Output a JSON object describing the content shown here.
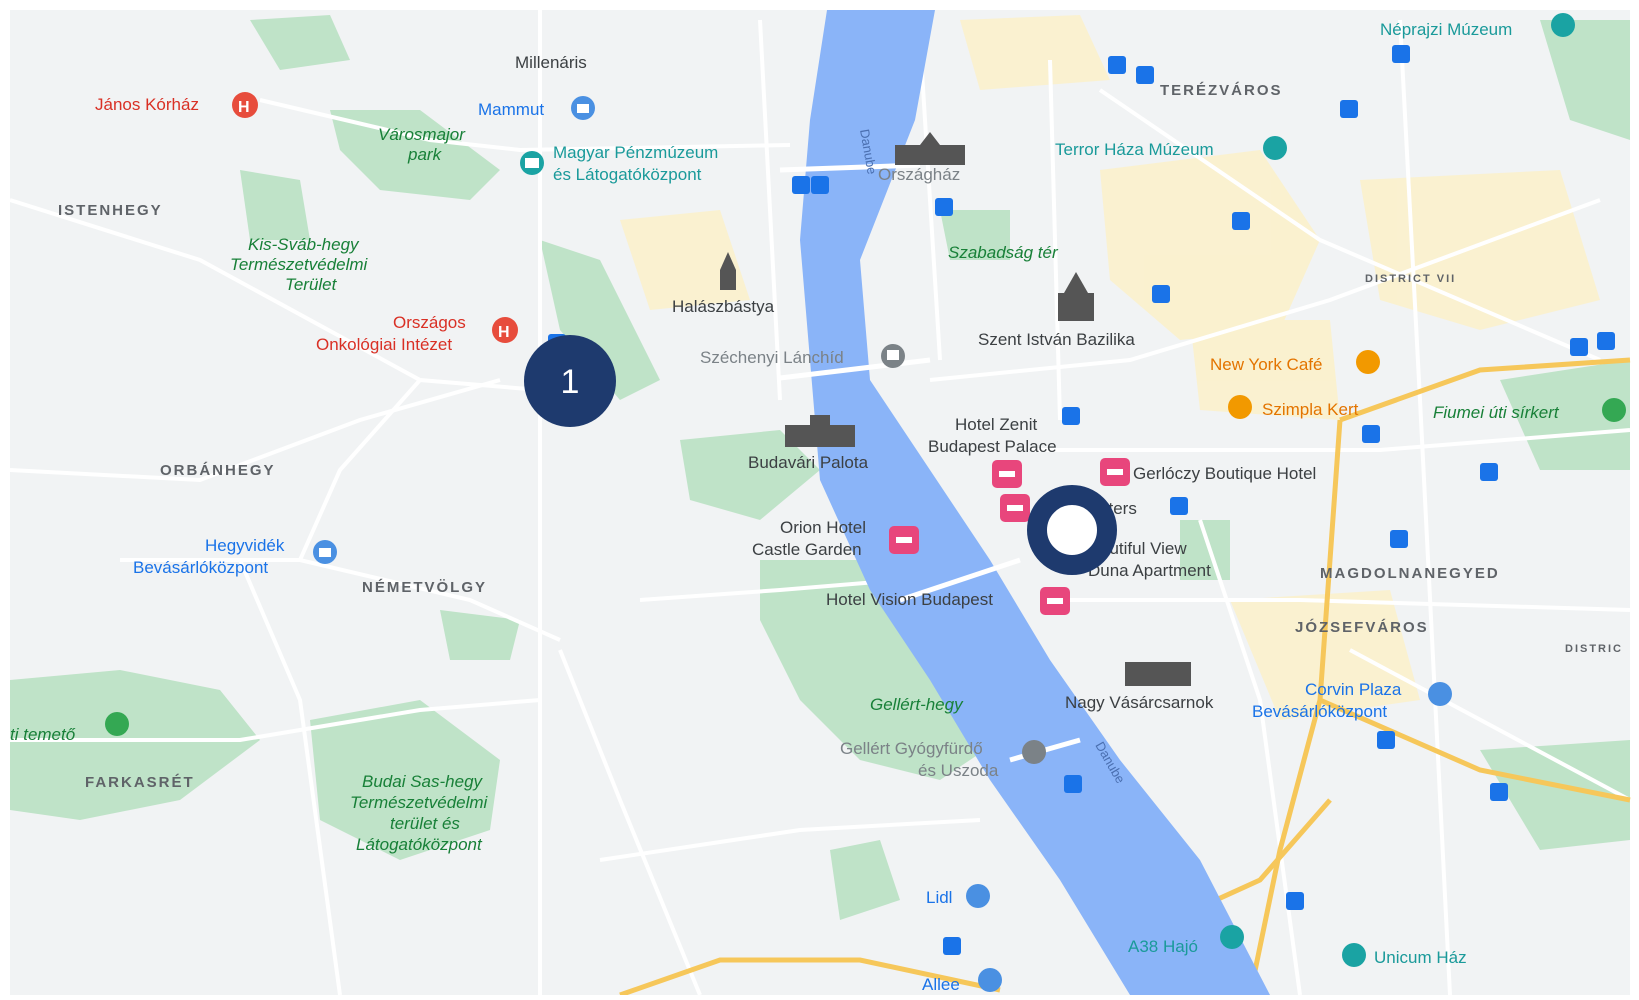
{
  "map": {
    "districts": [
      "ISTENHEGY",
      "ORBÁNHEGY",
      "NÉMETVÖLGY",
      "FARKASRÉT",
      "TERÉZVÁROS",
      "DISTRICT VII",
      "MAGDOLNANEGYED",
      "JÓZSEFVÁROS",
      "DISTRIC"
    ],
    "places": {
      "janos": "János Kórház",
      "mammut": "Mammut",
      "millenaris": "Millenáris",
      "varosmajor1": "Városmajor",
      "varosmajor2": "park",
      "penzmuzeum1": "Magyar Pénzmúzeum",
      "penzmuzeum2": "és Látogatóközpont",
      "orszaghaz": "Országház",
      "terror": "Terror Háza Múzeum",
      "neprajzi": "Néprajzi Múzeum",
      "kissvab1": "Kis-Sváb-hegy",
      "kissvab2": "Természetvédelmi",
      "kissvab3": "Terület",
      "onko1": "Országos",
      "onko2": "Onkológiai Intézet",
      "halasz": "Halászbástya",
      "szabadsag": "Szabadság tér",
      "bazilika": "Szent István Bazilika",
      "newyork": "New York Café",
      "szimpla": "Szimpla Kert",
      "fiumei": "Fiumei úti sírkert",
      "lanchid": "Széchenyi Lánchíd",
      "palota": "Budavári Palota",
      "zenit1": "Hotel Zenit",
      "zenit2": "Budapest Palace",
      "gerloczy": "Gerlóczy Boutique Hotel",
      "sters": "sters",
      "beautiful1": "autiful View",
      "beautiful2": "Duna Apartment",
      "orion1": "Orion Hotel",
      "orion2": "Castle Garden",
      "vision": "Hotel Vision Budapest",
      "hegyvidek1": "Hegyvidék",
      "hegyvidek2": "Bevásárlóközpont",
      "nagyvasar": "Nagy Vásárcsarnok",
      "corvin1": "Corvin Plaza",
      "corvin2": "Bevásárlóközpont",
      "gellerthegy": "Gellért-hegy",
      "gellertf1": "Gellért Gyógyfürdő",
      "gellertf2": "és Uszoda",
      "temeto": "ti temető",
      "sashegy1": "Budai Sas-hegy",
      "sashegy2": "Természetvédelmi",
      "sashegy3": "terület és",
      "sashegy4": "Látogatóközpont",
      "lidl": "Lidl",
      "a38": "A38 Hajó",
      "unicum": "Unicum Ház",
      "allee": "Allee"
    },
    "river": "Danube",
    "markers": [
      {
        "label": "1",
        "style": "numbered",
        "color": "#1e3a6e"
      },
      {
        "label": "",
        "style": "ring",
        "color": "#1e3a6e"
      }
    ],
    "colors": {
      "land": "#f1f3f4",
      "water": "#8ab4f8",
      "park": "#a8dab5",
      "urban": "#fdf3d0",
      "arterial": "#f9c74f",
      "road": "#ffffff",
      "marker": "#1e3a6e",
      "hotel": "#e8467c"
    },
    "icons": [
      "hospital-icon",
      "shopping-icon",
      "museum-icon",
      "hotel-icon",
      "metro-icon",
      "landmark-icon",
      "restaurant-icon",
      "bar-icon",
      "park-icon",
      "ferry-icon"
    ]
  }
}
